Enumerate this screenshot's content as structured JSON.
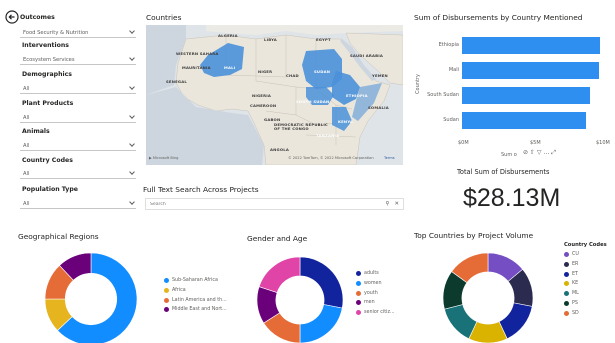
{
  "filters": {
    "outcomes_label": "Outcomes",
    "outcomes_value": "Food Security & Nutrition",
    "interventions_label": "Interventions",
    "interventions_value": "Ecosystem Services",
    "demographics_label": "Demographics",
    "demographics_value": "All",
    "plant_products_label": "Plant Products",
    "plant_products_value": "All",
    "animals_label": "Animals",
    "animals_value": "All",
    "country_codes_label": "Country Codes",
    "country_codes_value": "All",
    "population_type_label": "Population Type",
    "population_type_value": "All"
  },
  "map": {
    "title": "Countries",
    "attribution": "© 2022 TomTom, © 2022 Microsoft Corporation",
    "terms": "Terms",
    "labels": [
      "LIBYA",
      "EGYPT",
      "SAUDI ARABIA",
      "ALGERIA",
      "WESTERN SAHARA",
      "MAURITANIA",
      "MALI",
      "NIGER",
      "CHAD",
      "SUDAN",
      "YEMEN",
      "SENEGAL",
      "NIGERIA",
      "ETHIOPIA",
      "CAMEROON",
      "SOUTH SUDAN",
      "SOMALIA",
      "GABON",
      "DEMOCRATIC REPUBLIC OF THE CONGO",
      "KENYA",
      "TANZANIA",
      "ANGOLA"
    ]
  },
  "search": {
    "title": "Full Text Search Across Projects",
    "placeholder": "Search"
  },
  "kpi": {
    "title": "Total Sum of Disbursements",
    "value": "$28.13M"
  },
  "colors": {
    "bar": "#2e8ff0",
    "map_highlight": "#4a90d9",
    "accent_blue": "#118dff"
  },
  "chart_data": [
    {
      "type": "bar",
      "orientation": "horizontal",
      "title": "Sum of Disbursements by Country Mentioned",
      "categories": [
        "Ethiopia",
        "Mali",
        "South Sudan",
        "Sudan"
      ],
      "values": [
        9.6,
        9.5,
        8.9,
        8.6
      ],
      "ylabel": "Country",
      "xlabel": "Sum o",
      "xticks": [
        "$0M",
        "$5M",
        "$10M"
      ],
      "xlim": [
        0,
        10
      ]
    },
    {
      "type": "pie",
      "title": "Geographical Regions",
      "labels": [
        "Sub-Saharan Africa",
        "Africa",
        "Latin America and th...",
        "Middle East and Nort..."
      ],
      "values": [
        63,
        12,
        13,
        12
      ],
      "colors": [
        "#118dff",
        "#e6b41e",
        "#e66c37",
        "#6b007b"
      ]
    },
    {
      "type": "pie",
      "title": "Gender and Age",
      "labels": [
        "adults",
        "women",
        "youth",
        "men",
        "senior citiz..."
      ],
      "values": [
        28,
        22,
        16,
        14,
        20
      ],
      "colors": [
        "#12239e",
        "#118dff",
        "#e66c37",
        "#6b007b",
        "#e044a7"
      ]
    },
    {
      "type": "pie",
      "title": "Top Countries by Project Volume",
      "legend_title": "Country Codes",
      "labels": [
        "CU",
        "ER",
        "ET",
        "KE",
        "ML",
        "PS",
        "SD"
      ],
      "values": [
        14,
        14,
        15,
        14,
        14,
        14,
        15
      ],
      "colors": [
        "#744ec2",
        "#2b2b4f",
        "#12239e",
        "#d9b300",
        "#197278",
        "#0c3b2e",
        "#e66c37"
      ],
      "extra_colors": [
        "#5bd667",
        "#d64550"
      ]
    }
  ]
}
